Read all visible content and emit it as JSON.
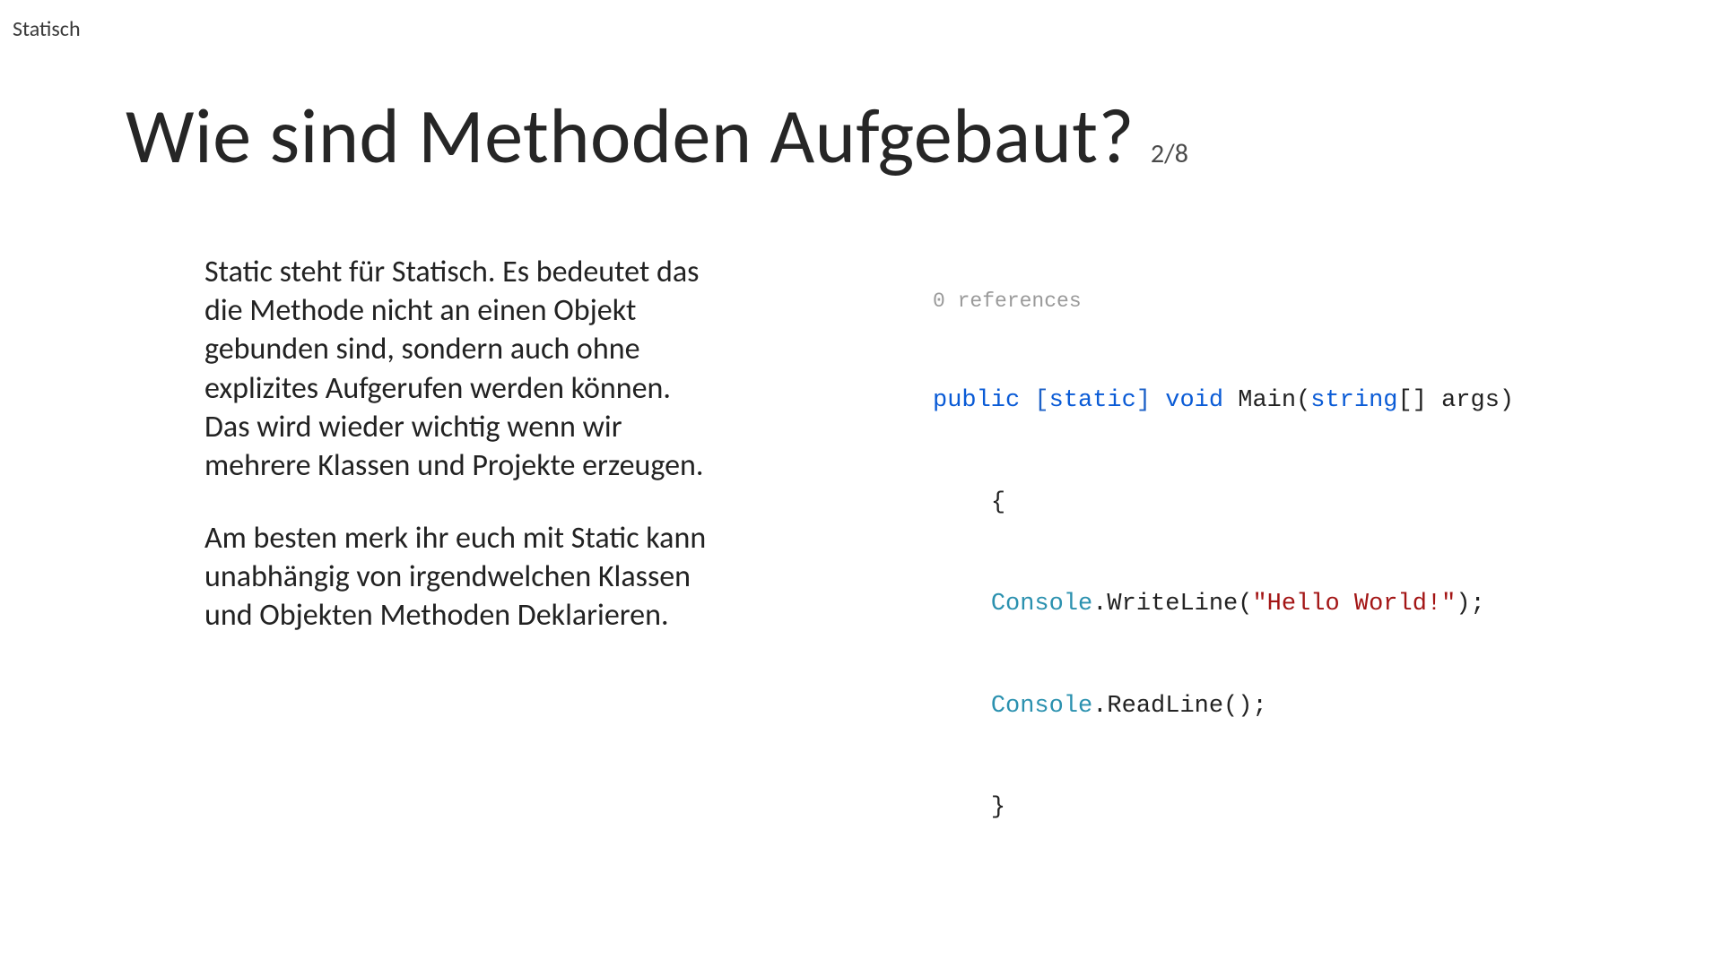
{
  "header": {
    "top_label": "Statisch",
    "title": "Wie sind Methoden Aufgebaut?",
    "page_indicator": "2/8"
  },
  "body": {
    "paragraph1": "Static steht für Statisch.\nEs bedeutet das die Methode nicht an einen Objekt gebunden sind, sondern auch ohne explizites Aufgerufen werden können.\nDas wird wieder wichtig wenn wir mehrere Klassen und Projekte erzeugen.",
    "paragraph2": "Am besten merk ihr euch mit Static kann unabhängig von irgendwelchen Klassen und Objekten Methoden Deklarieren."
  },
  "code": {
    "references_label": "0 references",
    "kw_public": "public",
    "bracket_open": "[",
    "kw_static": "static",
    "bracket_close": "]",
    "kw_void": "void",
    "method_name": "Main",
    "params_open": "(",
    "kw_string": "string",
    "kw_arr": "[]",
    "param_name": " args",
    "params_close": ")",
    "brace_open": "{",
    "cls_console1": "Console",
    "call_writeline": ".WriteLine(",
    "str_hello": "\"Hello World!\"",
    "call_writeline_end": ");",
    "cls_console2": "Console",
    "call_readline": ".ReadLine();",
    "brace_close": "}"
  }
}
